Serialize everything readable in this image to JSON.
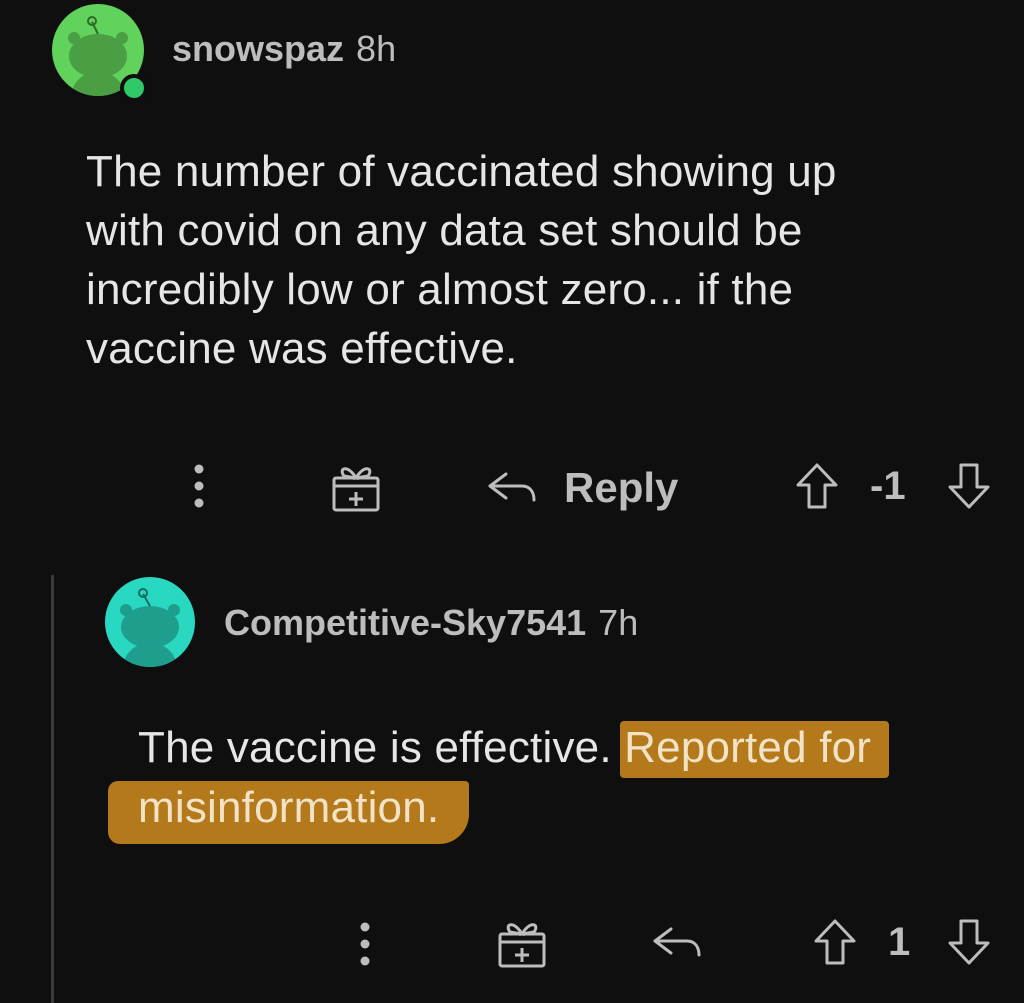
{
  "colors": {
    "background": "#0f0f0f",
    "avatar_green": "#61d25b",
    "avatar_teal": "#29d8c1",
    "online_dot": "#2fc96a",
    "highlight": "#b3791b"
  },
  "comments": [
    {
      "username": "snowspaz",
      "time": "8h",
      "avatar_icon": "snoo-avatar-icon",
      "online": true,
      "body_lines": [
        "The number of vaccinated showing up",
        "with covid on any data set should be",
        "incredibly low or almost zero... if the",
        "vaccine was effective."
      ],
      "actions": {
        "more_icon": "more-vertical-icon",
        "award_icon": "gift-award-icon",
        "reply_icon": "reply-arrow-icon",
        "reply_label": "Reply",
        "upvote_icon": "upvote-arrow-icon",
        "score": "-1",
        "downvote_icon": "downvote-arrow-icon"
      }
    },
    {
      "username": "Competitive-Sky7541",
      "time": "7h",
      "avatar_icon": "snoo-avatar-icon",
      "body_plain": "The vaccine is effective. ",
      "body_highlight_1": "Reported for",
      "body_highlight_2": "misinformation.",
      "actions": {
        "more_icon": "more-vertical-icon",
        "award_icon": "gift-award-icon",
        "reply_icon": "reply-arrow-icon",
        "upvote_icon": "upvote-arrow-icon",
        "score": "1",
        "downvote_icon": "downvote-arrow-icon"
      }
    }
  ]
}
